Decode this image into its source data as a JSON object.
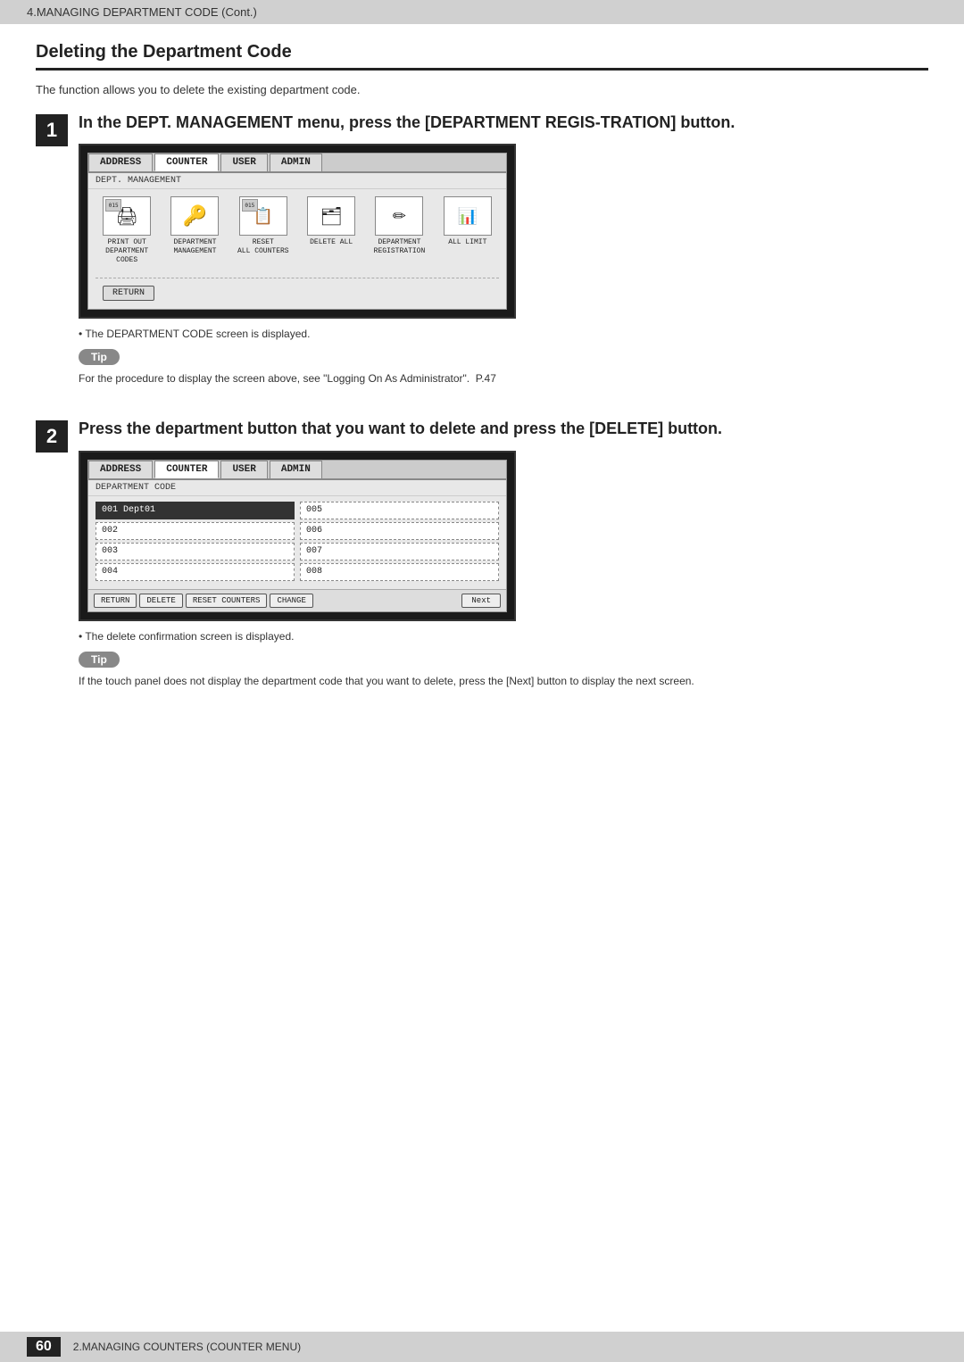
{
  "top_bar": {
    "text": "4.MANAGING DEPARTMENT CODE (Cont.)"
  },
  "page_title": "Deleting the Department Code",
  "page_description": "The function allows you to delete the existing department code.",
  "step1": {
    "number": "1",
    "title": "In the DEPT. MANAGEMENT menu, press the [DEPARTMENT REGIS-TRATION] button.",
    "tabs": [
      "ADDRESS",
      "COUNTER",
      "USER",
      "ADMIN"
    ],
    "active_tab": "COUNTER",
    "screen_label": "DEPT. MANAGEMENT",
    "icons": [
      {
        "label": "PRINT OUT\nDEPARTMENT CODES",
        "icon": "🖨"
      },
      {
        "label": "DEPARTMENT\nMANAGEMENT",
        "icon": "🔑"
      },
      {
        "label": "RESET\nALL COUNTERS",
        "icon": "📋"
      },
      {
        "label": "DELETE ALL",
        "icon": "🗂"
      },
      {
        "label": "DEPARTMENT\nREGISTRATION",
        "icon": "✏"
      },
      {
        "label": "ALL LIMIT",
        "icon": "📊"
      }
    ],
    "return_btn": "RETURN",
    "bullet_note": "The DEPARTMENT CODE screen is displayed.",
    "tip_label": "Tip",
    "tip_text": "For the procedure to display the screen above, see \"Logging On As Administrator\".   P.47"
  },
  "step2": {
    "number": "2",
    "title": "Press the department button that you want to delete and press the [DELETE] button.",
    "tabs": [
      "ADDRESS",
      "COUNTER",
      "USER",
      "ADMIN"
    ],
    "active_tab": "COUNTER",
    "screen_label": "DEPARTMENT CODE",
    "dept_entries": [
      {
        "left": "001 Dept01",
        "right": "005",
        "left_selected": true
      },
      {
        "left": "002",
        "right": "006"
      },
      {
        "left": "003",
        "right": "007"
      },
      {
        "left": "004",
        "right": "008"
      }
    ],
    "bottom_buttons": [
      "RETURN",
      "DELETE",
      "RESET COUNTERS",
      "CHANGE"
    ],
    "next_btn": "Next",
    "bullet_note": "The delete confirmation screen is displayed.",
    "tip_label": "Tip",
    "tip_text": "If the touch panel does not display the department code that you want to delete, press the [Next] button to display the next screen."
  },
  "bottom_bar": {
    "page_number": "60",
    "text": "2.MANAGING COUNTERS (COUNTER MENU)"
  }
}
